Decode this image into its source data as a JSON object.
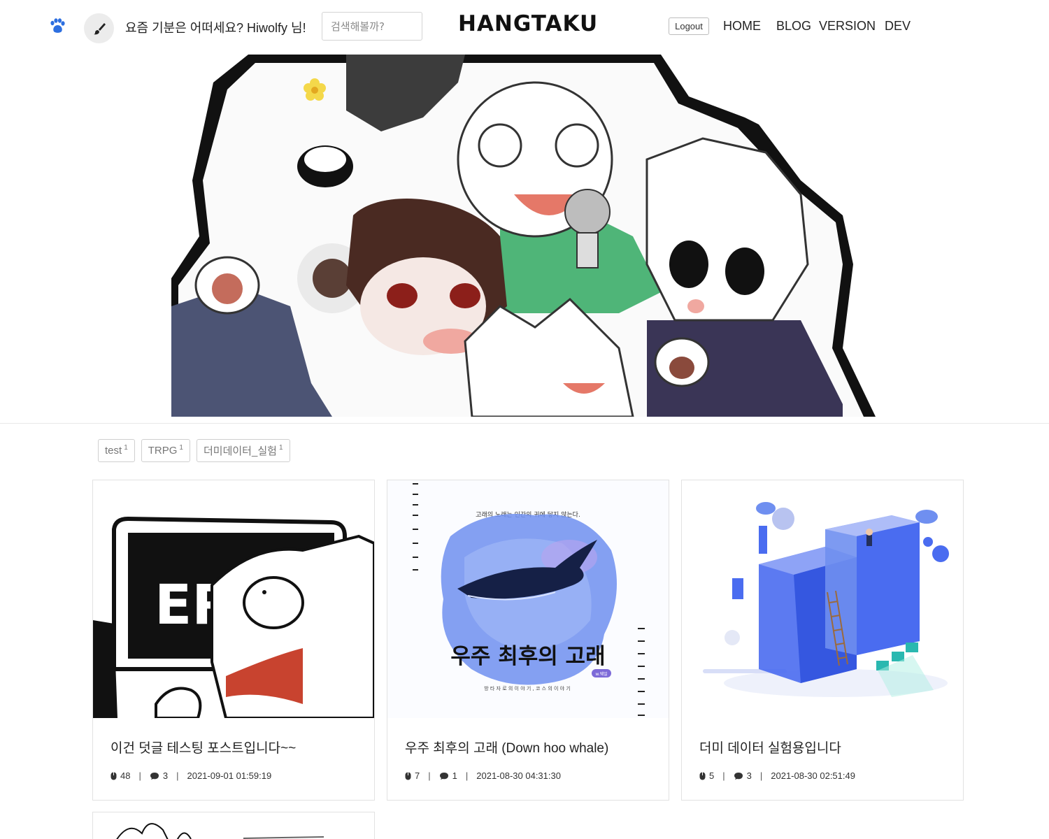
{
  "header": {
    "greeting": "요즘 기분은 어떠세요? Hiwolfy 님!",
    "search_placeholder": "검색해볼까?",
    "brand": "HANGTAKU",
    "logout_label": "Logout",
    "nav": [
      {
        "label": "HOME"
      },
      {
        "label": "BLOG"
      },
      {
        "label": "VERSION"
      },
      {
        "label": "DEV"
      }
    ]
  },
  "tags": [
    {
      "label": "test",
      "count": "1"
    },
    {
      "label": "TRPG",
      "count": "1"
    },
    {
      "label": "더미데이터_실험",
      "count": "1"
    }
  ],
  "posts": [
    {
      "title": "이건 덧글 테스팅 포스트입니다~~",
      "views": "48",
      "comments": "3",
      "date": "2021-09-01 01:59:19",
      "thumb_text": "ERR"
    },
    {
      "title": "우주 최후의 고래 (Down hoo whale)",
      "views": "7",
      "comments": "1",
      "date": "2021-08-30 04:31:30",
      "thumb_caption": "고래의 노래는 인간의 귀에 닿지 않는다.",
      "thumb_title": "우주 최후의 고래",
      "thumb_badge": "w.웨일",
      "thumb_sub": "방 타 자 로 의   이 야 기 ,   코 스 의   이 야 기"
    },
    {
      "title": "더미 데이터 실험용입니다",
      "views": "5",
      "comments": "3",
      "date": "2021-08-30 02:51:49"
    }
  ],
  "colors": {
    "paw": "#2d6fe0",
    "whale_paint": "#6f8ff0",
    "iso_blue": "#4a6cf0",
    "scarf": "#c8432f"
  }
}
